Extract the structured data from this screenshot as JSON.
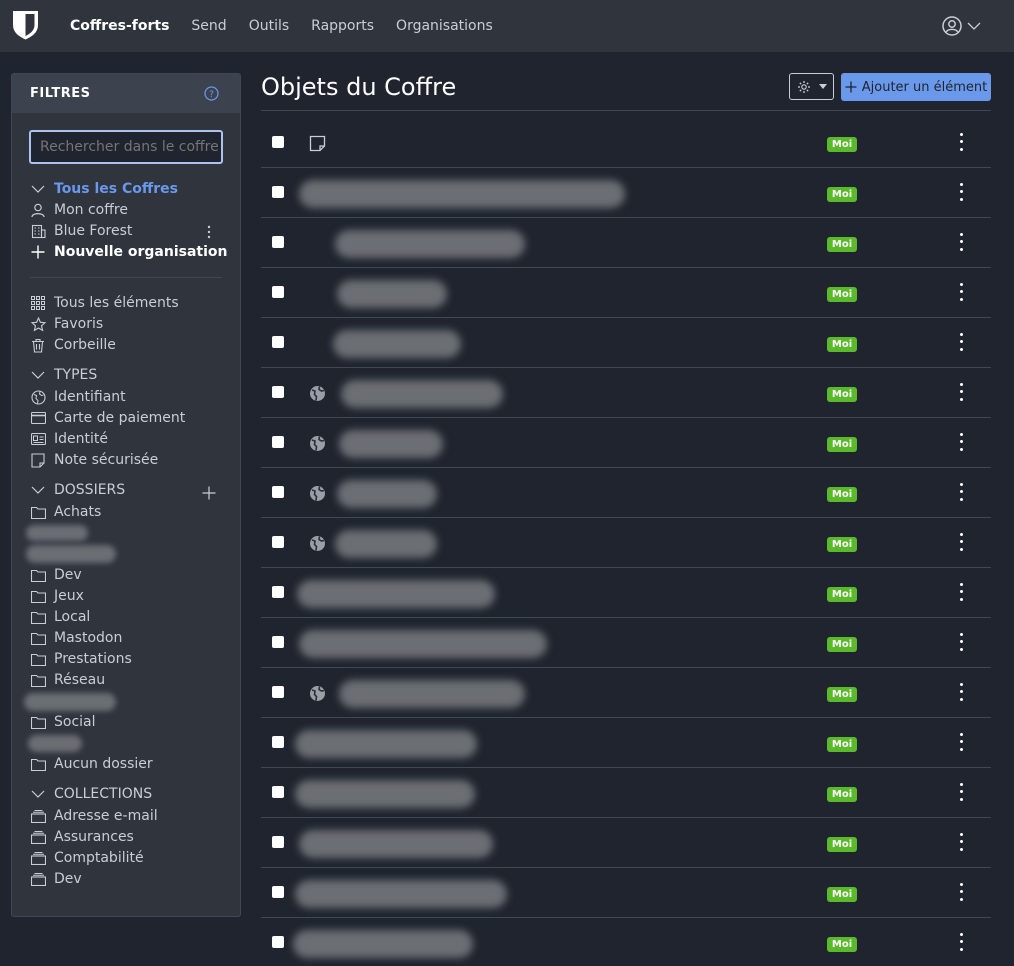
{
  "nav": {
    "items": [
      {
        "label": "Coffres-forts",
        "active": true
      },
      {
        "label": "Send",
        "active": false
      },
      {
        "label": "Outils",
        "active": false
      },
      {
        "label": "Rapports",
        "active": false
      },
      {
        "label": "Organisations",
        "active": false
      }
    ],
    "account_icon": "user-circle-icon"
  },
  "sidebar": {
    "title": "FILTRES",
    "search_placeholder": "Rechercher dans le coffre",
    "vaults": {
      "all": "Tous les Coffres",
      "mine": "Mon coffre",
      "org": "Blue Forest",
      "new_org": "Nouvelle organisation"
    },
    "items": {
      "all": "Tous les éléments",
      "favorites": "Favoris",
      "trash": "Corbeille"
    },
    "types": {
      "header": "TYPES",
      "login": "Identifiant",
      "card": "Carte de paiement",
      "identity": "Identité",
      "note": "Note sécurisée"
    },
    "folders": {
      "header": "DOSSIERS",
      "list": [
        "Achats",
        "Dev",
        "Jeux",
        "Local",
        "Mastodon",
        "Prestations",
        "Réseau",
        "Social",
        "Aucun dossier"
      ]
    },
    "collections": {
      "header": "COLLECTIONS",
      "list": [
        "Adresse e-mail",
        "Assurances",
        "Comptabilité",
        "Dev"
      ]
    }
  },
  "main": {
    "title": "Objets du Coffre",
    "add_label": "Ajouter un élément",
    "owner_badge": "Moi",
    "rows": [
      {
        "type": "note"
      },
      {
        "type": "none"
      },
      {
        "type": "none"
      },
      {
        "type": "none"
      },
      {
        "type": "none"
      },
      {
        "type": "globe"
      },
      {
        "type": "globe"
      },
      {
        "type": "globe"
      },
      {
        "type": "globe"
      },
      {
        "type": "none"
      },
      {
        "type": "none"
      },
      {
        "type": "globe"
      },
      {
        "type": "none"
      },
      {
        "type": "none"
      },
      {
        "type": "none"
      },
      {
        "type": "none"
      },
      {
        "type": "none"
      }
    ]
  },
  "colors": {
    "background": "#1f242e",
    "panel": "#2f343d",
    "accent": "#6a99ec",
    "badge": "#5aba2b"
  }
}
